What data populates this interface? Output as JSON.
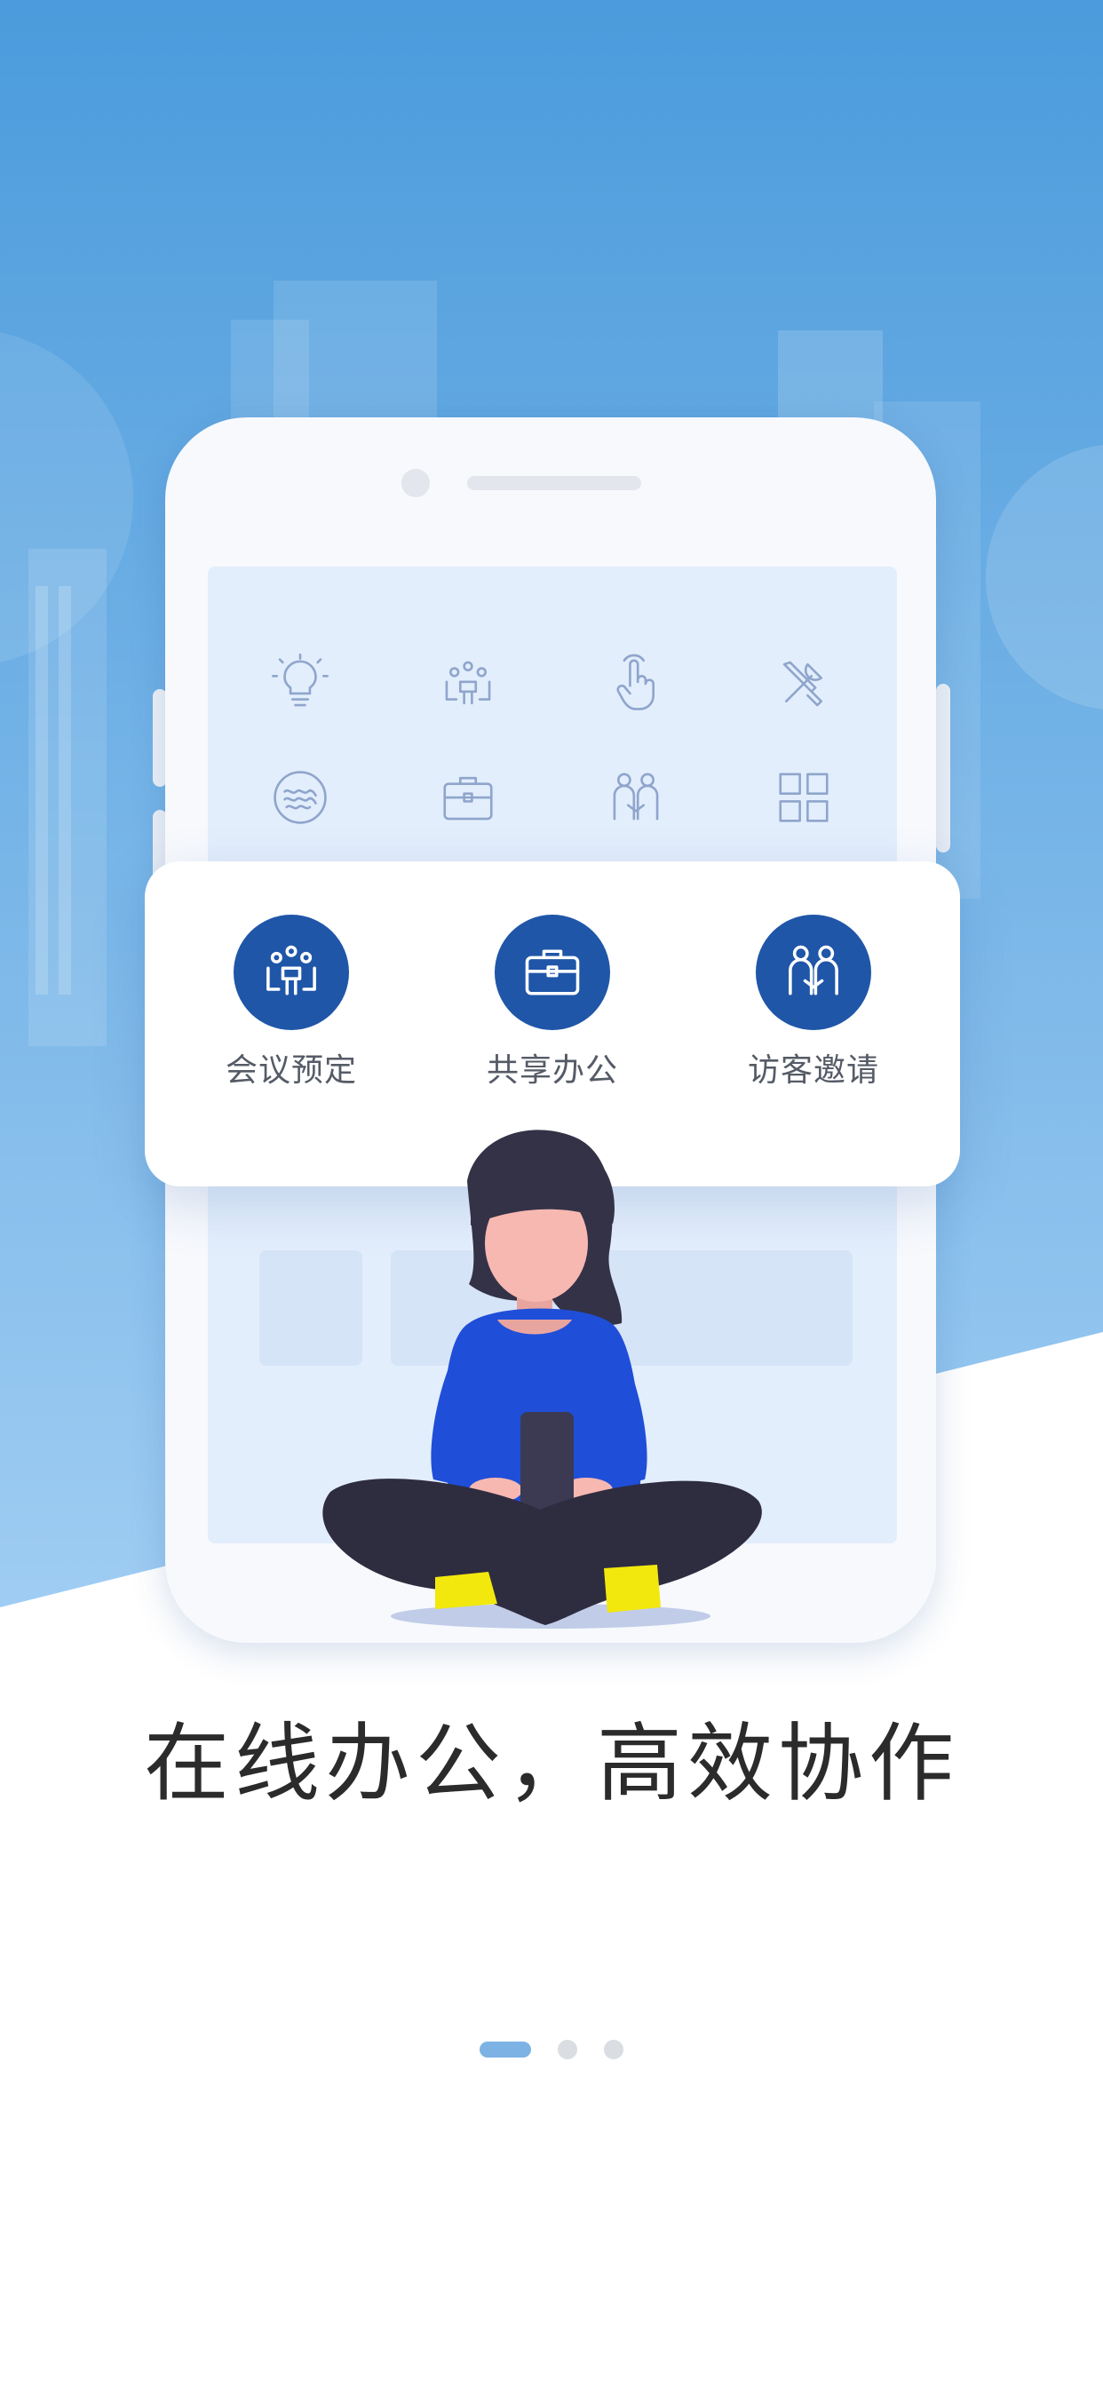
{
  "colors": {
    "sky_top": "#4b9bdc",
    "sky_bottom": "#9fcdf2",
    "accent": "#1f56a8",
    "icon_outline": "#8fa5cc",
    "indicator_active": "#7cb3e4",
    "indicator_inactive": "#dadde2",
    "headline": "#2b2b2b"
  },
  "screen_icons": [
    {
      "icon": "lightbulb-icon"
    },
    {
      "icon": "meeting-icon"
    },
    {
      "icon": "hand-tap-icon"
    },
    {
      "icon": "tools-icon"
    },
    {
      "icon": "waves-icon"
    },
    {
      "icon": "briefcase-icon"
    },
    {
      "icon": "visitors-icon"
    },
    {
      "icon": "grid-icon"
    }
  ],
  "features": [
    {
      "label": "会议预定",
      "icon": "meeting-icon"
    },
    {
      "label": "共享办公",
      "icon": "briefcase-icon"
    },
    {
      "label": "访客邀请",
      "icon": "visitors-icon"
    }
  ],
  "headline": "在线办公，高效协作",
  "pager": {
    "total": 3,
    "active": 1
  }
}
